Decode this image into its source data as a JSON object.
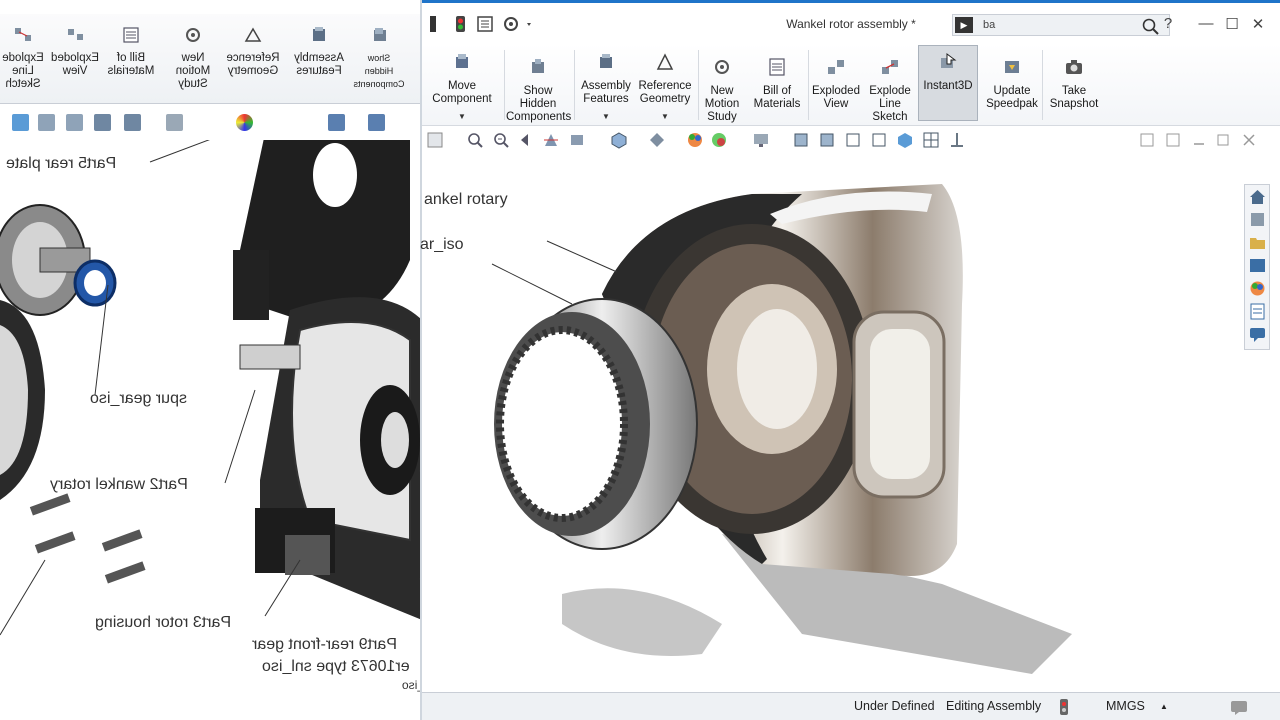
{
  "window": {
    "title": "Wankel rotor assembly *",
    "search_value": "ba",
    "search_cmd_glyph": "▶",
    "help_glyph": "?",
    "minimize_glyph": "—",
    "maximize_glyph": "☐",
    "close_glyph": "✕"
  },
  "ribbon": {
    "buttons": [
      {
        "label": "Move\nComponent",
        "icon": "move-component-icon"
      },
      {
        "label": "Show\nHidden\nComponents",
        "icon": "show-hidden-icon"
      },
      {
        "label": "Assembly\nFeatures",
        "icon": "assembly-features-icon"
      },
      {
        "label": "Reference\nGeometry",
        "icon": "reference-geometry-icon"
      },
      {
        "label": "New\nMotion\nStudy",
        "icon": "motion-study-icon"
      },
      {
        "label": "Bill of\nMaterials",
        "icon": "bom-icon"
      },
      {
        "label": "Exploded\nView",
        "icon": "exploded-view-icon"
      },
      {
        "label": "Explode\nLine\nSketch",
        "icon": "explode-line-icon"
      },
      {
        "label": "Instant3D",
        "icon": "instant3d-icon"
      },
      {
        "label": "Update\nSpeedpak",
        "icon": "speedpak-icon"
      },
      {
        "label": "Take\nSnapshot",
        "icon": "camera-icon"
      }
    ]
  },
  "left_toolbar": {
    "buttons": [
      {
        "label": "Show\nHidden\nComponents"
      },
      {
        "label": "Assembly\nFeatures"
      },
      {
        "label": "Reference\nGeometry"
      },
      {
        "label": "New\nMotion\nStudy"
      },
      {
        "label": "Bill of\nMaterials"
      },
      {
        "label": "Exploded\nView"
      },
      {
        "label": "Explode\nLine\nSketch"
      }
    ]
  },
  "graphics": {
    "callouts": {
      "wankel_rotary": "ankel rotary",
      "ar_iso": "ar_iso"
    }
  },
  "left_callouts": {
    "rear_plate": "Part5 rear plate",
    "spur_gear": "spur gear_iso",
    "wankel_rotary": "Part2 wankel rotary",
    "rotor_housing": "Part3 rotor housing",
    "rear_front_gear": "Part9 rear-front gear",
    "type_snl": "er10673 type snl_iso",
    "iso_fragment": "d_iso"
  },
  "status": {
    "under_defined": "Under Defined",
    "editing": "Editing Assembly",
    "units": "MMGS",
    "units_caret": "▲"
  },
  "colors": {
    "accent": "#1f74c9",
    "ribbon_bg": "#f3f5f8",
    "active_button": "#d7dbe0",
    "part_blue": "#2357a8"
  }
}
